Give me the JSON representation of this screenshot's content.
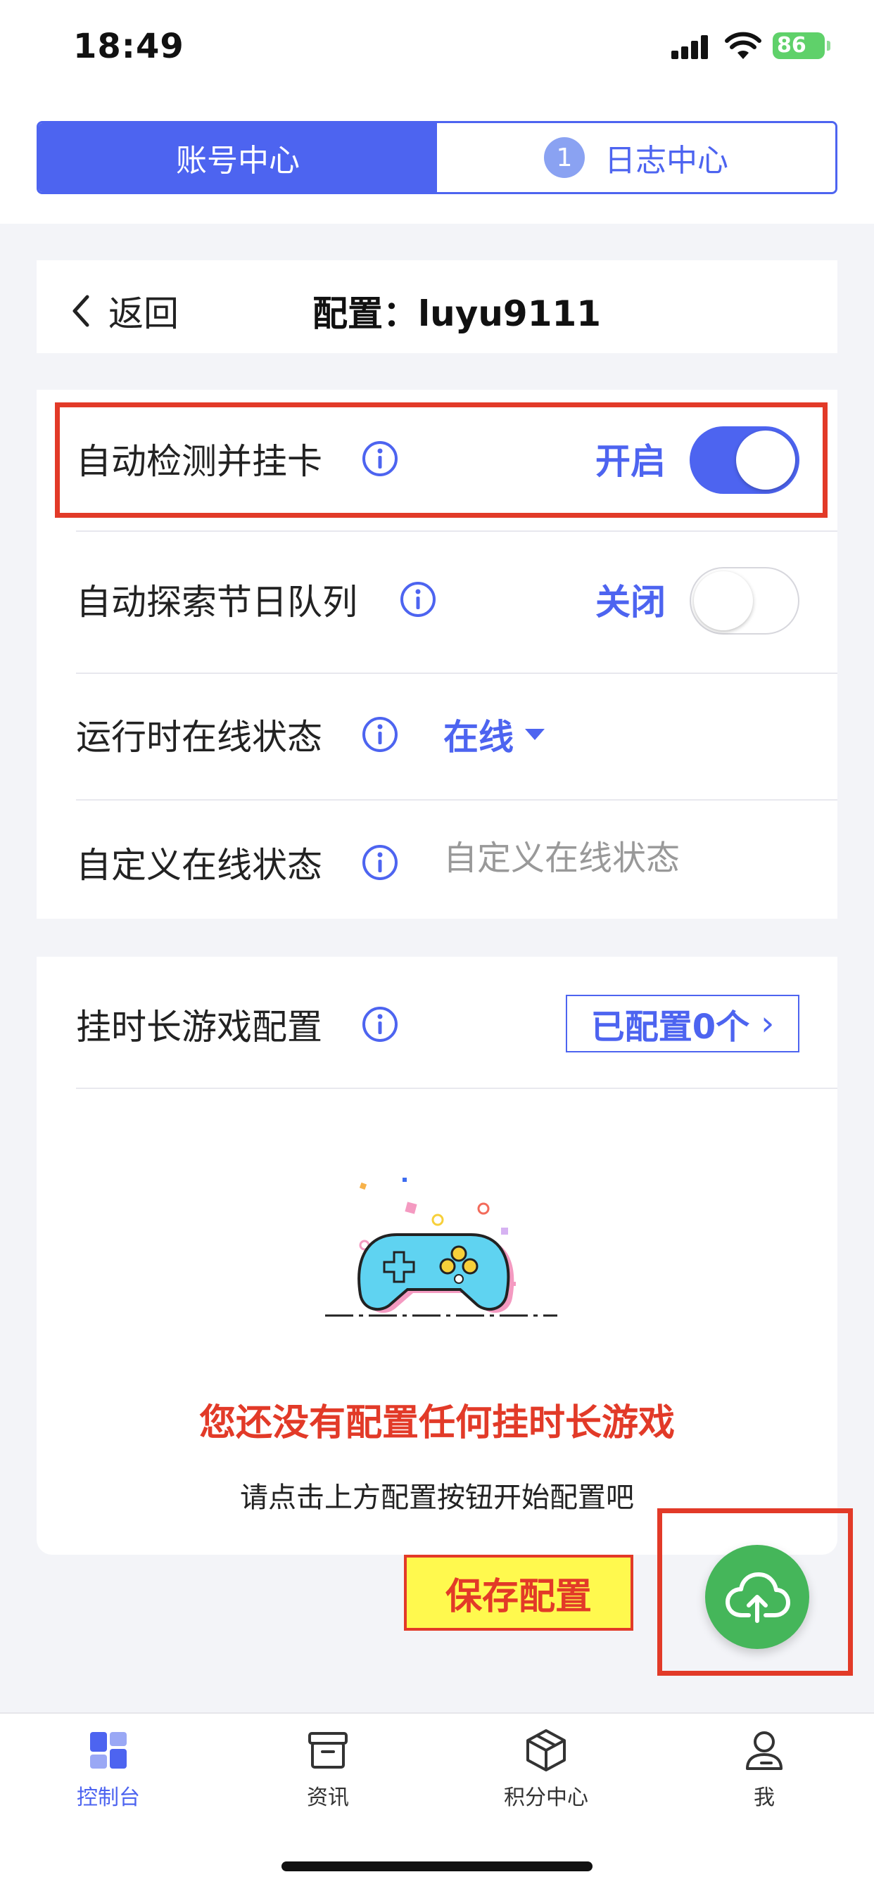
{
  "status_bar": {
    "time": "18:49",
    "battery": "86"
  },
  "tabs": [
    {
      "label": "账号中心"
    },
    {
      "label": "日志中心",
      "badge": "1"
    }
  ],
  "header": {
    "back_label": "返回",
    "title": "配置：luyu9111"
  },
  "settings": {
    "auto_detect": {
      "label": "自动检测并挂卡",
      "status": "开启",
      "enabled": true
    },
    "auto_explore": {
      "label": "自动探索节日队列",
      "status": "关闭",
      "enabled": false
    },
    "runtime_status": {
      "label": "运行时在线状态",
      "value": "在线"
    },
    "custom_status": {
      "label": "自定义在线状态",
      "placeholder": "自定义在线状态"
    }
  },
  "game_config": {
    "label": "挂时长游戏配置",
    "button": "已配置0个",
    "button_chevron": "›",
    "empty_title": "您还没有配置任何挂时长游戏",
    "empty_subtitle": "请点击上方配置按钮开始配置吧"
  },
  "annotation": {
    "save_label": "保存配置"
  },
  "bottom_nav": [
    {
      "label": "控制台",
      "icon": "dashboard-icon"
    },
    {
      "label": "资讯",
      "icon": "archive-icon"
    },
    {
      "label": "积分中心",
      "icon": "cube-icon"
    },
    {
      "label": "我",
      "icon": "user-icon"
    }
  ],
  "colors": {
    "primary": "#4d64f0",
    "annotation_red": "#e23a28",
    "fab_green": "#45b65a",
    "highlight_yellow": "#fff94e"
  }
}
